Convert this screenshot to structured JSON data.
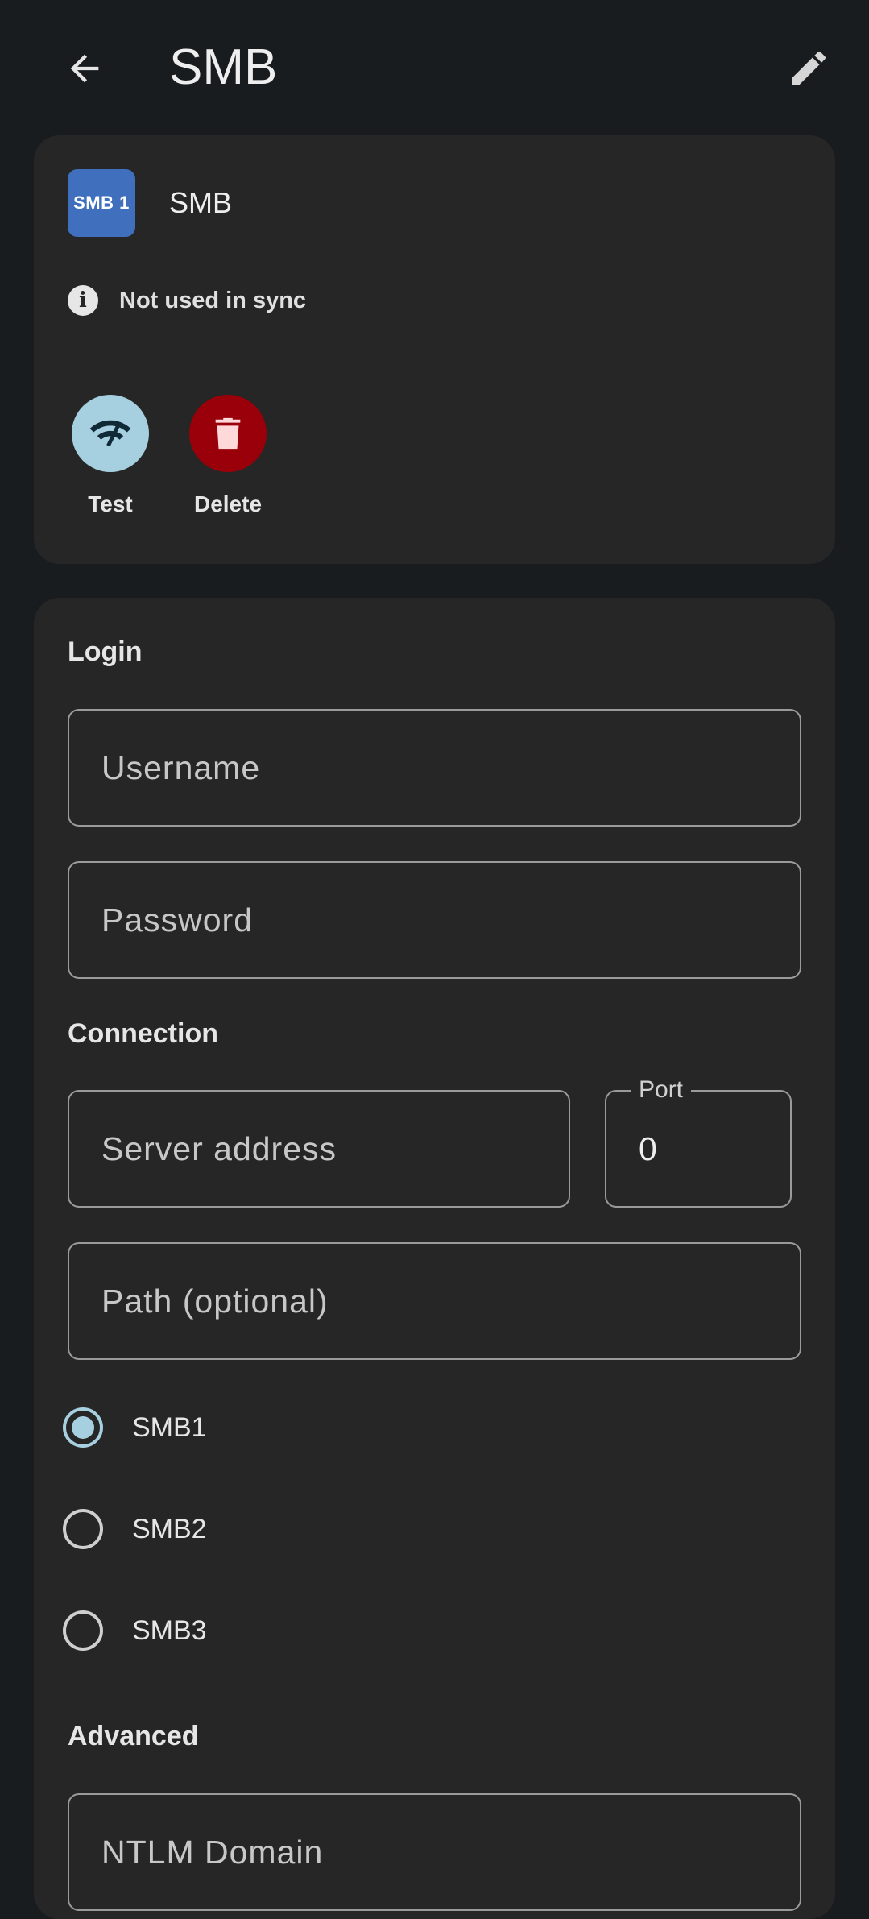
{
  "appbar": {
    "title": "SMB",
    "back_icon": "arrow-back-icon",
    "edit_icon": "pencil-icon"
  },
  "remote": {
    "badge": "SMB 1",
    "badge_color": "#3f6fbd",
    "name": "SMB",
    "sync_status": "Not used in sync"
  },
  "actions": {
    "test_label": "Test",
    "delete_label": "Delete",
    "test_color": "#a6cfe0",
    "delete_color": "#99000a"
  },
  "login": {
    "section_title": "Login",
    "username_placeholder": "Username",
    "password_placeholder": "Password"
  },
  "connection": {
    "section_title": "Connection",
    "server_placeholder": "Server address",
    "port_label": "Port",
    "port_value": "0",
    "path_placeholder": "Path (optional)",
    "protocols": [
      {
        "label": "SMB1",
        "selected": true
      },
      {
        "label": "SMB2",
        "selected": false
      },
      {
        "label": "SMB3",
        "selected": false
      }
    ]
  },
  "advanced": {
    "section_title": "Advanced",
    "ntlm_placeholder": "NTLM Domain"
  }
}
